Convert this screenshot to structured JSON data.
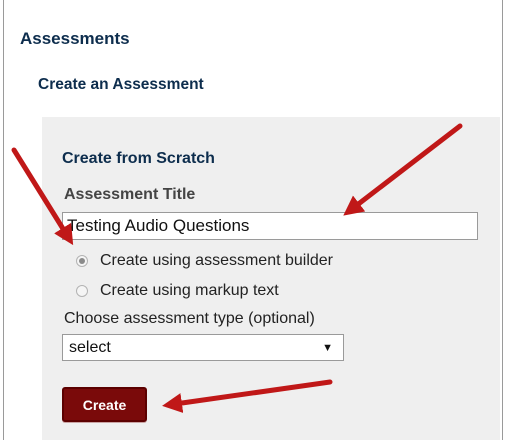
{
  "header": {
    "title": "Assessments",
    "subtitle": "Create an Assessment"
  },
  "form": {
    "section_title": "Create from Scratch",
    "title_label": "Assessment Title",
    "title_value": "Testing Audio Questions",
    "radio_options": [
      {
        "label": "Create using assessment builder",
        "checked": true
      },
      {
        "label": "Create using markup text",
        "checked": false
      }
    ],
    "type_label": "Choose assessment type (optional)",
    "type_selected": "select",
    "create_label": "Create"
  },
  "colors": {
    "heading": "#0d2d4d",
    "panel_bg": "#efefef",
    "button_bg": "#7a0a0a",
    "arrow": "#c01818"
  },
  "annotations": {
    "arrow_count": 3,
    "arrow_icon": "red-arrow-icon"
  }
}
